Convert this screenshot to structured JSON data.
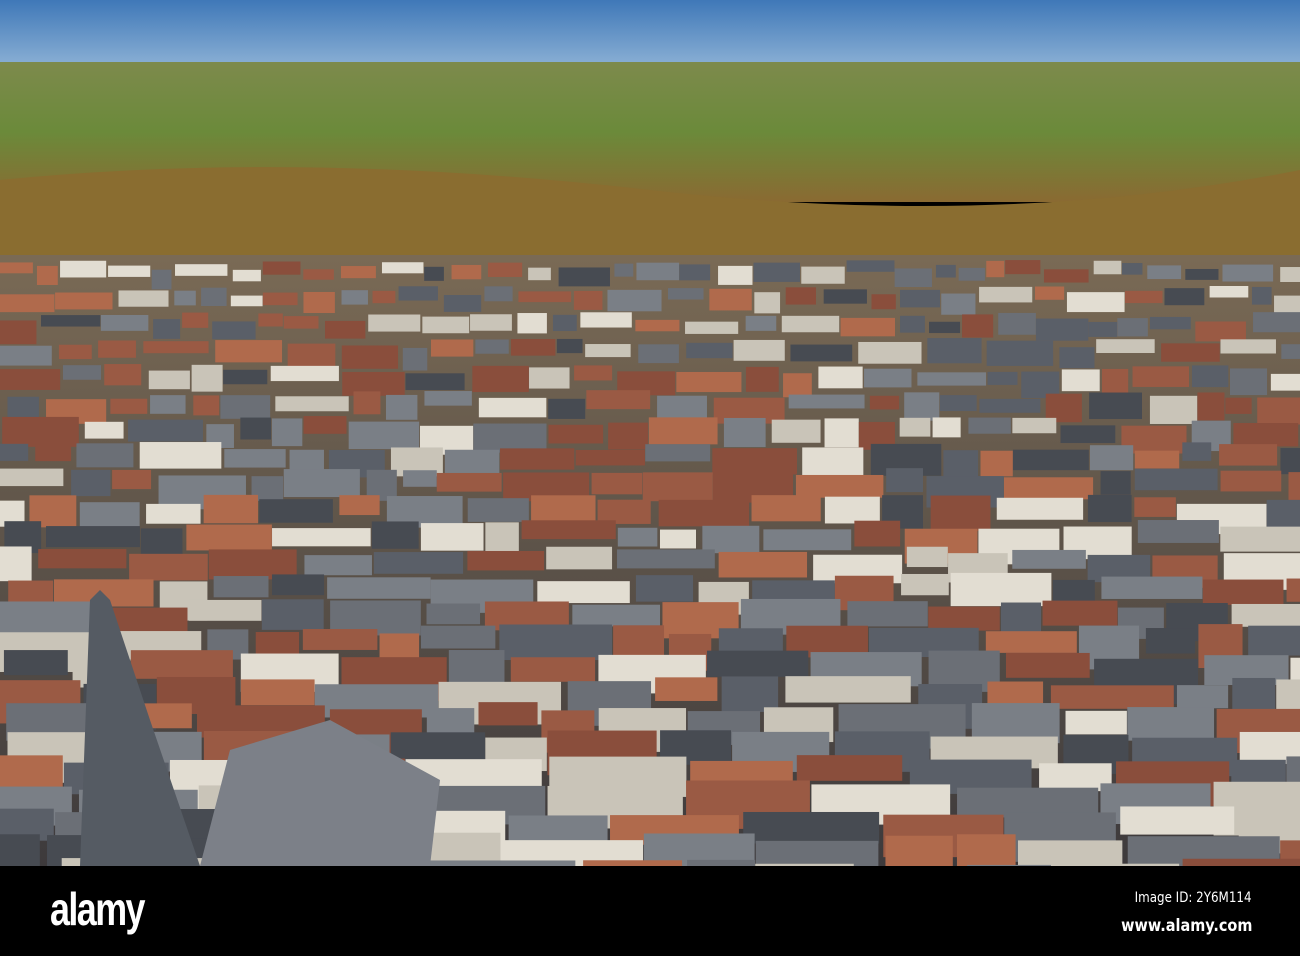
{
  "photo": {
    "subject": "aerial-town-view",
    "colors": {
      "sky": "#4f86c0",
      "fields": "#6f8a3c",
      "autumn_trees": "#9a7a3a",
      "roofs": "#5a5f68",
      "brick": "#9a5a44"
    }
  },
  "footer": {
    "logo": "alamy",
    "image_id": "Image ID: 2Y6M114",
    "url": "www.alamy.com"
  }
}
